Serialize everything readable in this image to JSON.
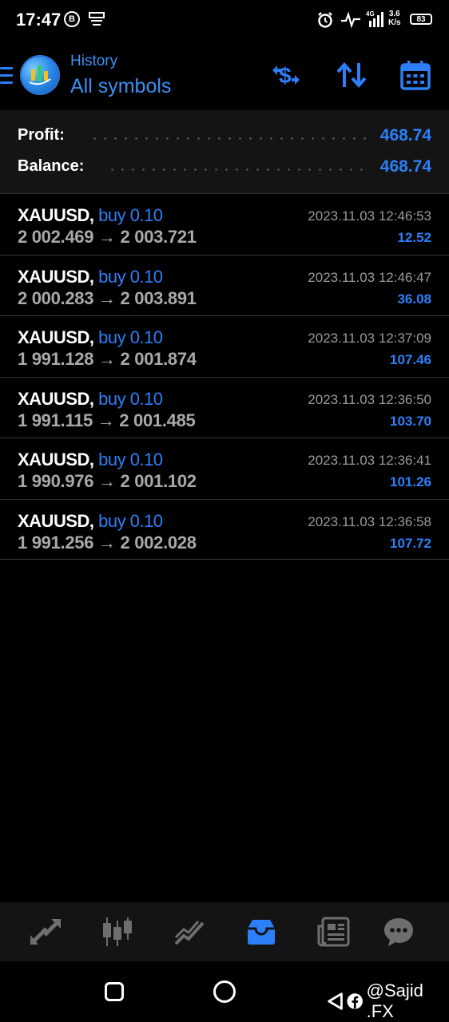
{
  "status_bar": {
    "time": "17:47",
    "battery": "83",
    "net_speed_value": "3.6",
    "net_speed_unit": "K/s",
    "network_type": "4G"
  },
  "header": {
    "subtitle": "History",
    "title": "All symbols"
  },
  "summary": {
    "profit_label": "Profit:",
    "profit_value": "468.74",
    "balance_label": "Balance:",
    "balance_value": "468.74"
  },
  "trades": [
    {
      "symbol": "XAUUSD,",
      "side": "buy 0.10",
      "open_price": "2 002.469",
      "close_price": "2 003.721",
      "time": "2023.11.03 12:46:53",
      "profit": "12.52"
    },
    {
      "symbol": "XAUUSD,",
      "side": "buy 0.10",
      "open_price": "2 000.283",
      "close_price": "2 003.891",
      "time": "2023.11.03 12:46:47",
      "profit": "36.08"
    },
    {
      "symbol": "XAUUSD,",
      "side": "buy 0.10",
      "open_price": "1 991.128",
      "close_price": "2 001.874",
      "time": "2023.11.03 12:37:09",
      "profit": "107.46"
    },
    {
      "symbol": "XAUUSD,",
      "side": "buy 0.10",
      "open_price": "1 991.115",
      "close_price": "2 001.485",
      "time": "2023.11.03 12:36:50",
      "profit": "103.70"
    },
    {
      "symbol": "XAUUSD,",
      "side": "buy 0.10",
      "open_price": "1 990.976",
      "close_price": "2 001.102",
      "time": "2023.11.03 12:36:41",
      "profit": "101.26"
    },
    {
      "symbol": "XAUUSD,",
      "side": "buy 0.10",
      "open_price": "1 991.256",
      "close_price": "2 002.028",
      "time": "2023.11.03 12:36:58",
      "profit": "107.72"
    }
  ],
  "price_arrow": "→",
  "bottom_nav": [
    {
      "icon": "quotes-icon",
      "active": false
    },
    {
      "icon": "chart-icon",
      "active": false
    },
    {
      "icon": "trade-icon",
      "active": false
    },
    {
      "icon": "history-icon",
      "active": true
    },
    {
      "icon": "news-icon",
      "active": false
    },
    {
      "icon": "chat-icon",
      "active": false
    }
  ],
  "watermark": "@Sajid .FX",
  "colors": {
    "accent": "#2d7ff9",
    "background": "#000000",
    "panel": "#141414",
    "muted_text": "#a9a9a9"
  }
}
